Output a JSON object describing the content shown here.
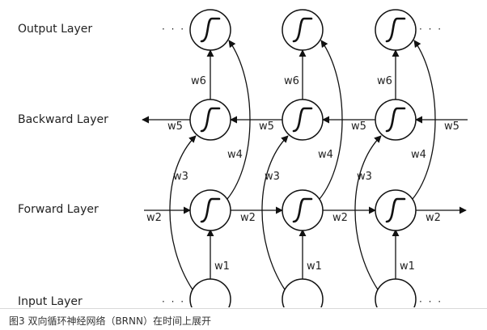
{
  "layers": {
    "output": "Output Layer",
    "backward": "Backward Layer",
    "forward": "Forward Layer",
    "input": "Input Layer"
  },
  "weights": {
    "w1": "w1",
    "w2": "w2",
    "w3": "w3",
    "w4": "w4",
    "w5": "w5",
    "w6": "w6"
  },
  "ellipsis": "· · ·",
  "caption": "图3 双向循环神经网络（BRNN）在时间上展开",
  "colors": {
    "stroke": "#111111",
    "text": "#222222"
  }
}
